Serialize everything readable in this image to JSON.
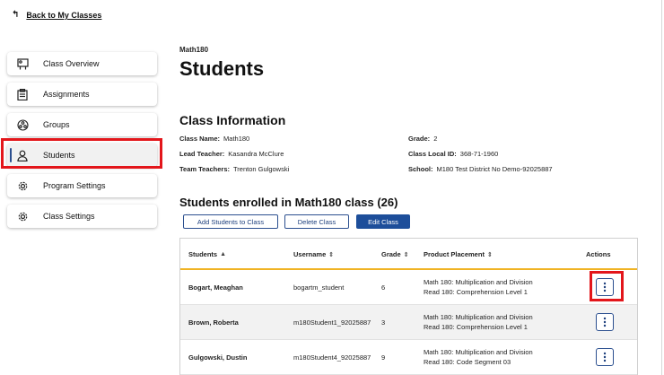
{
  "back_link": {
    "label": "Back to My Classes"
  },
  "sidebar": {
    "items": [
      {
        "label": "Class Overview",
        "icon": "class-overview-icon"
      },
      {
        "label": "Assignments",
        "icon": "clipboard-icon"
      },
      {
        "label": "Groups",
        "icon": "groups-icon"
      },
      {
        "label": "Students",
        "icon": "student-icon",
        "active": true
      },
      {
        "label": "Program Settings",
        "icon": "gear-icon"
      },
      {
        "label": "Class Settings",
        "icon": "gear-icon"
      }
    ]
  },
  "header": {
    "course": "Math180",
    "title": "Students"
  },
  "class_info": {
    "title": "Class Information",
    "class_name": {
      "label": "Class Name:",
      "value": "Math180"
    },
    "lead_teacher": {
      "label": "Lead Teacher:",
      "value": "Kasandra McClure"
    },
    "team_teachers": {
      "label": "Team Teachers:",
      "value": "Trenton Gulgowski"
    },
    "grade": {
      "label": "Grade:",
      "value": "2"
    },
    "class_local_id": {
      "label": "Class Local ID:",
      "value": "368-71-1960"
    },
    "school": {
      "label": "School:",
      "value": "M180 Test District No Demo-92025887"
    }
  },
  "enrolled": {
    "title": "Students enrolled in Math180 class (26)"
  },
  "buttons": {
    "add_students": "Add Students to Class",
    "delete_class": "Delete Class",
    "edit_class": "Edit Class"
  },
  "table": {
    "headers": {
      "students": "Students",
      "username": "Username",
      "grade": "Grade",
      "product_placement": "Product Placement",
      "actions": "Actions"
    },
    "rows": [
      {
        "name": "Bogart, Meaghan",
        "username": "bogartm_student",
        "grade": "6",
        "placement_1": "Math 180: Multiplication and Division",
        "placement_2": "Read 180: Comprehension Level 1"
      },
      {
        "name": "Brown, Roberta",
        "username": "m180Student1_92025887",
        "grade": "3",
        "placement_1": "Math 180: Multiplication and Division",
        "placement_2": "Read 180: Comprehension Level 1"
      },
      {
        "name": "Gulgowski, Dustin",
        "username": "m180Student4_92025887",
        "grade": "9",
        "placement_1": "Math 180: Multiplication and Division",
        "placement_2": "Read 180: Code Segment 03"
      }
    ]
  },
  "colors": {
    "accent": "#1d4e9a",
    "highlight": "#e3161b",
    "header_underline": "#f0b323"
  }
}
